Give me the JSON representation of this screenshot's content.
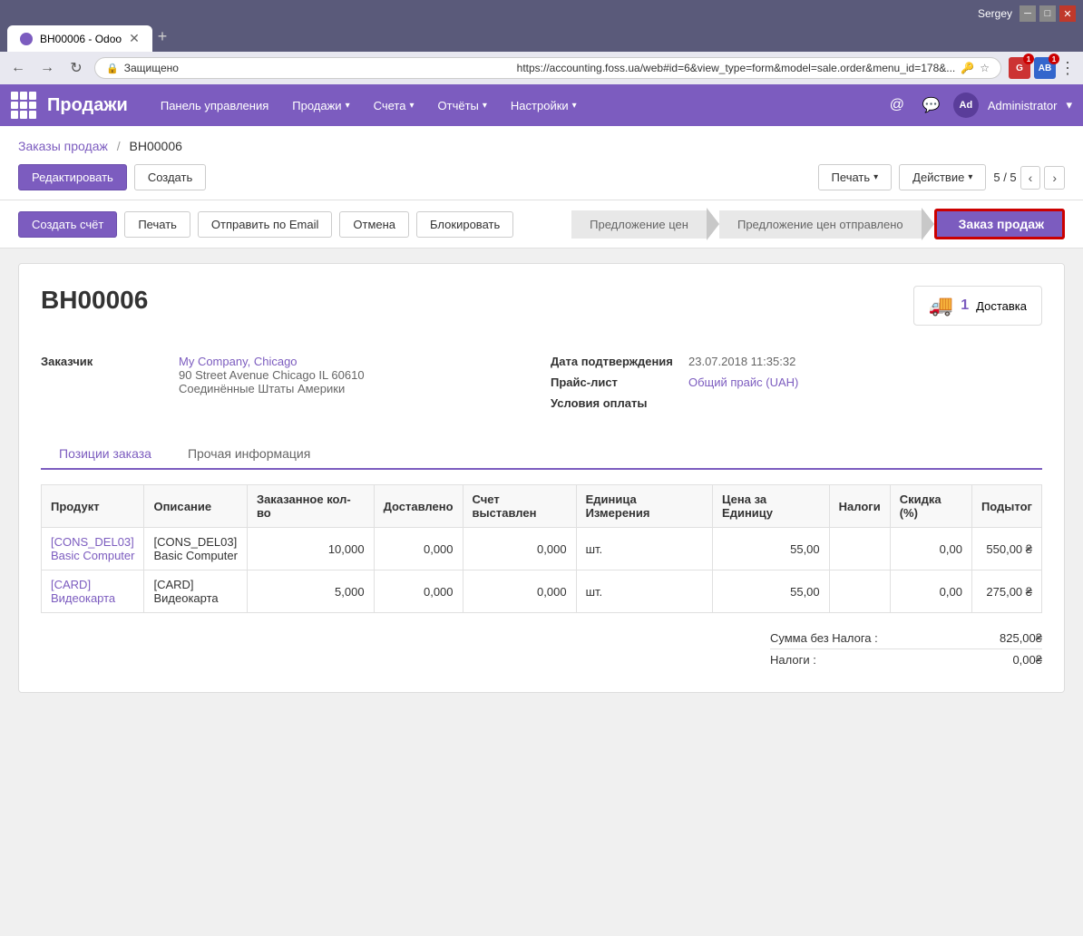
{
  "browser": {
    "tab_title": "ВН00006 - Odoo",
    "url": "https://accounting.foss.ua/web#id=6&view_type=form&model=sale.order&menu_id=178&...",
    "secure_label": "Защищено",
    "user": "Sergey",
    "new_tab_tooltip": "New tab"
  },
  "topnav": {
    "brand": "Продажи",
    "items": [
      {
        "label": "Панель управления",
        "has_caret": false
      },
      {
        "label": "Продажи",
        "has_caret": true
      },
      {
        "label": "Счета",
        "has_caret": true
      },
      {
        "label": "Отчёты",
        "has_caret": true
      },
      {
        "label": "Настройки",
        "has_caret": true
      }
    ],
    "user_name": "Administrator",
    "user_initials": "Ad"
  },
  "breadcrumb": {
    "parent": "Заказы продаж",
    "current": "ВН00006"
  },
  "actions": {
    "edit": "Редактировать",
    "create": "Создать",
    "print": "Печать",
    "action": "Действие",
    "pagination": "5 / 5",
    "create_invoice": "Создать счёт",
    "print2": "Печать",
    "send_email": "Отправить по Email",
    "cancel": "Отмена",
    "block": "Блокировать"
  },
  "status_steps": [
    {
      "label": "Предложение цен",
      "active": false
    },
    {
      "label": "Предложение цен отправлено",
      "active": false
    },
    {
      "label": "Заказ продаж",
      "active": true
    }
  ],
  "order": {
    "number": "ВН00006",
    "delivery_count": "1",
    "delivery_label": "Доставка",
    "customer_label": "Заказчик",
    "customer_name": "My Company, Chicago",
    "customer_address": "90 Street Avenue Chicago IL 60610",
    "customer_country": "Соединённые Штаты Америки",
    "confirm_date_label": "Дата подтверждения",
    "confirm_date": "23.07.2018 11:35:32",
    "pricelist_label": "Прайс-лист",
    "pricelist": "Общий прайс (UAH)",
    "payment_label": "Условия оплаты",
    "payment_value": ""
  },
  "tabs": [
    {
      "label": "Позиции заказа",
      "active": true
    },
    {
      "label": "Прочая информация",
      "active": false
    }
  ],
  "table": {
    "columns": [
      "Продукт",
      "Описание",
      "Заказанное кол-во",
      "Доставлено",
      "Счет выставлен",
      "Единица Измерения",
      "Цена за Единицу",
      "Налоги",
      "Скидка (%)",
      "Подытог"
    ],
    "rows": [
      {
        "product": "[CONS_DEL03]",
        "product_sub": "Basic Computer",
        "description": "[CONS_DEL03]",
        "description_sub": "Basic Computer",
        "qty_ordered": "10,000",
        "qty_delivered": "0,000",
        "qty_invoiced": "0,000",
        "uom": "шт.",
        "price": "55,00",
        "taxes": "",
        "discount": "0,00",
        "subtotal": "550,00 ₴"
      },
      {
        "product": "[CARD]",
        "product_sub": "Видеокарта",
        "description": "[CARD]",
        "description_sub": "Видеокарта",
        "qty_ordered": "5,000",
        "qty_delivered": "0,000",
        "qty_invoiced": "0,000",
        "uom": "шт.",
        "price": "55,00",
        "taxes": "",
        "discount": "0,00",
        "subtotal": "275,00 ₴"
      }
    ]
  },
  "totals": {
    "subtotal_label": "Сумма без Налога :",
    "subtotal_value": "825,00₴",
    "tax_label": "Налоги :",
    "tax_value": "0,00₴"
  }
}
